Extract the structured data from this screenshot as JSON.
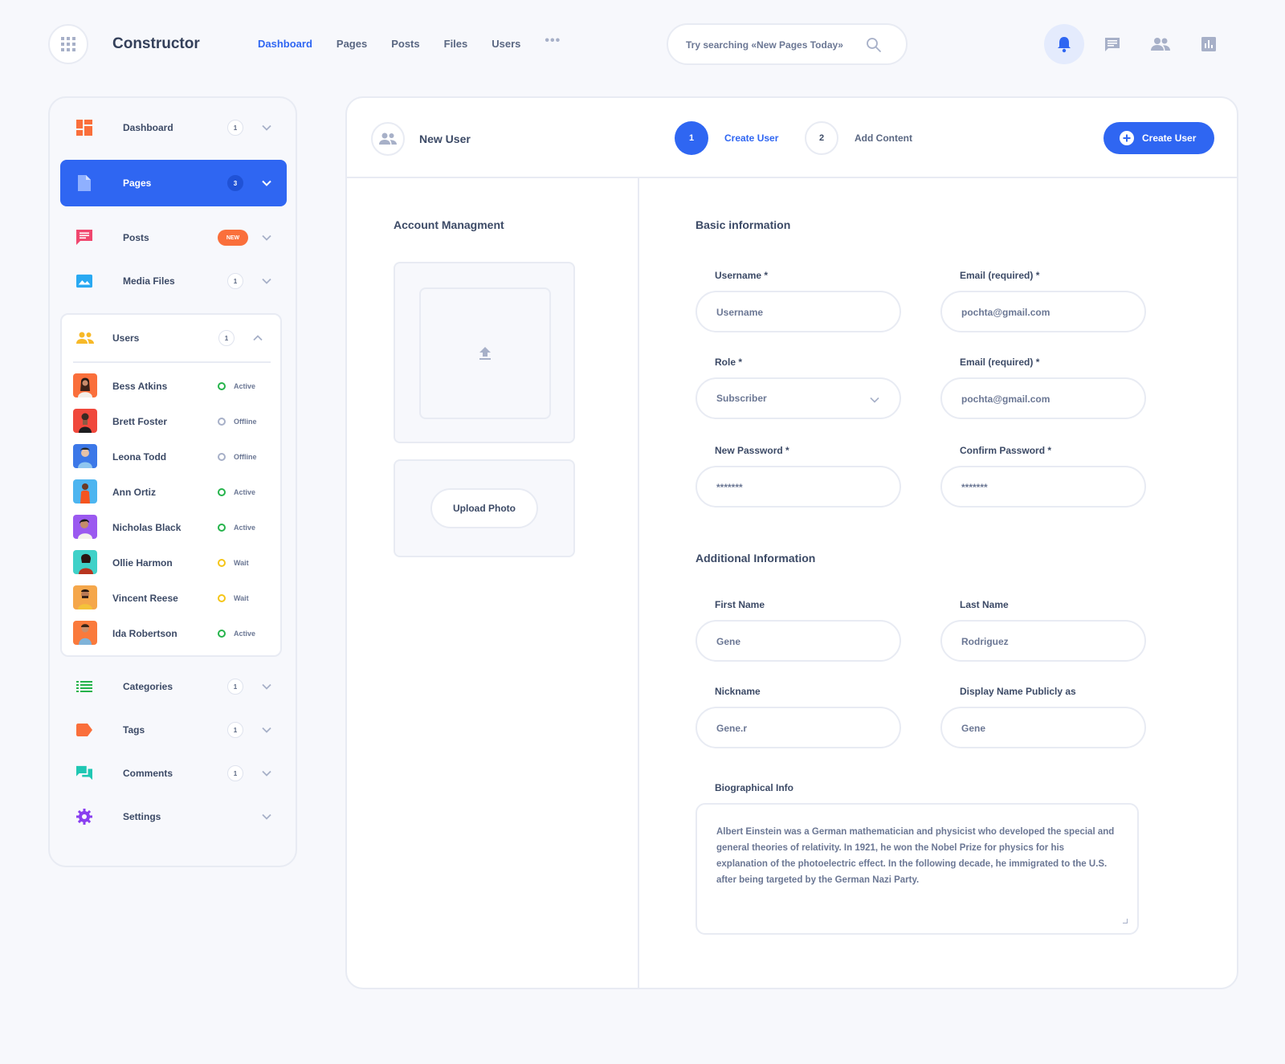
{
  "brand": "Constructor",
  "topnav": [
    "Dashboard",
    "Pages",
    "Posts",
    "Files",
    "Users"
  ],
  "topnav_more": "•••",
  "search": {
    "placeholder": "Try searching «New Pages Today»"
  },
  "colors": {
    "accent": "#2f66f2",
    "badge_new": "#fa6f3b",
    "active_status": "#25b34b",
    "offline_status": "#a7b0c8",
    "wait_status": "#f5c518"
  },
  "sidebar": {
    "items": [
      {
        "label": "Dashboard",
        "count": "1",
        "icon": "dashboard-icon"
      },
      {
        "label": "Pages",
        "count": "3",
        "icon": "page-icon"
      },
      {
        "label": "Posts",
        "badge": "NEW",
        "icon": "message-icon"
      },
      {
        "label": "Media Files",
        "count": "1",
        "icon": "image-icon"
      },
      {
        "label": "Users",
        "count": "1",
        "icon": "users-icon"
      },
      {
        "label": "Categories",
        "count": "1",
        "icon": "list-icon"
      },
      {
        "label": "Tags",
        "count": "1",
        "icon": "tag-icon"
      },
      {
        "label": "Comments",
        "count": "1",
        "icon": "comments-icon"
      },
      {
        "label": "Settings",
        "icon": "gear-icon"
      }
    ],
    "users": [
      {
        "name": "Bess Atkins",
        "status": "Active"
      },
      {
        "name": "Brett Foster",
        "status": "Offline"
      },
      {
        "name": "Leona Todd",
        "status": "Offline"
      },
      {
        "name": "Ann Ortiz",
        "status": "Active"
      },
      {
        "name": "Nicholas Black",
        "status": "Active"
      },
      {
        "name": "Ollie Harmon",
        "status": "Wait"
      },
      {
        "name": "Vincent Reese",
        "status": "Wait"
      },
      {
        "name": "Ida Robertson",
        "status": "Active"
      }
    ]
  },
  "main": {
    "title": "New User",
    "steps": [
      {
        "num": "1",
        "label": "Create User"
      },
      {
        "num": "2",
        "label": "Add Content"
      }
    ],
    "create_button": "Create User",
    "account_title": "Account Managment",
    "upload_button": "Upload Photo",
    "basic_title": "Basic information",
    "additional_title": "Additional Information",
    "fields": {
      "username": {
        "label": "Username *",
        "placeholder": "Username",
        "value": ""
      },
      "email1": {
        "label": "Email (required) *",
        "value": "pochta@gmail.com"
      },
      "role": {
        "label": "Role *",
        "value": "Subscriber"
      },
      "email2": {
        "label": "Email (required) *",
        "value": "pochta@gmail.com"
      },
      "new_password": {
        "label": "New Password *",
        "value": "*******"
      },
      "confirm_password": {
        "label": "Confirm Password *",
        "value": "*******"
      },
      "first_name": {
        "label": "First Name",
        "value": "Gene"
      },
      "last_name": {
        "label": "Last Name",
        "value": "Rodriguez"
      },
      "nickname": {
        "label": "Nickname",
        "value": "Gene.r"
      },
      "display_name": {
        "label": "Display Name Publicly as",
        "value": "Gene"
      },
      "bio": {
        "label": "Biographical Info",
        "value": "Albert Einstein was a German mathematician and physicist who developed the special and general theories of relativity. In 1921, he won the Nobel Prize for physics for his explanation of the photoelectric effect. In the following decade, he immigrated to the U.S. after being targeted by the German Nazi Party."
      }
    }
  }
}
